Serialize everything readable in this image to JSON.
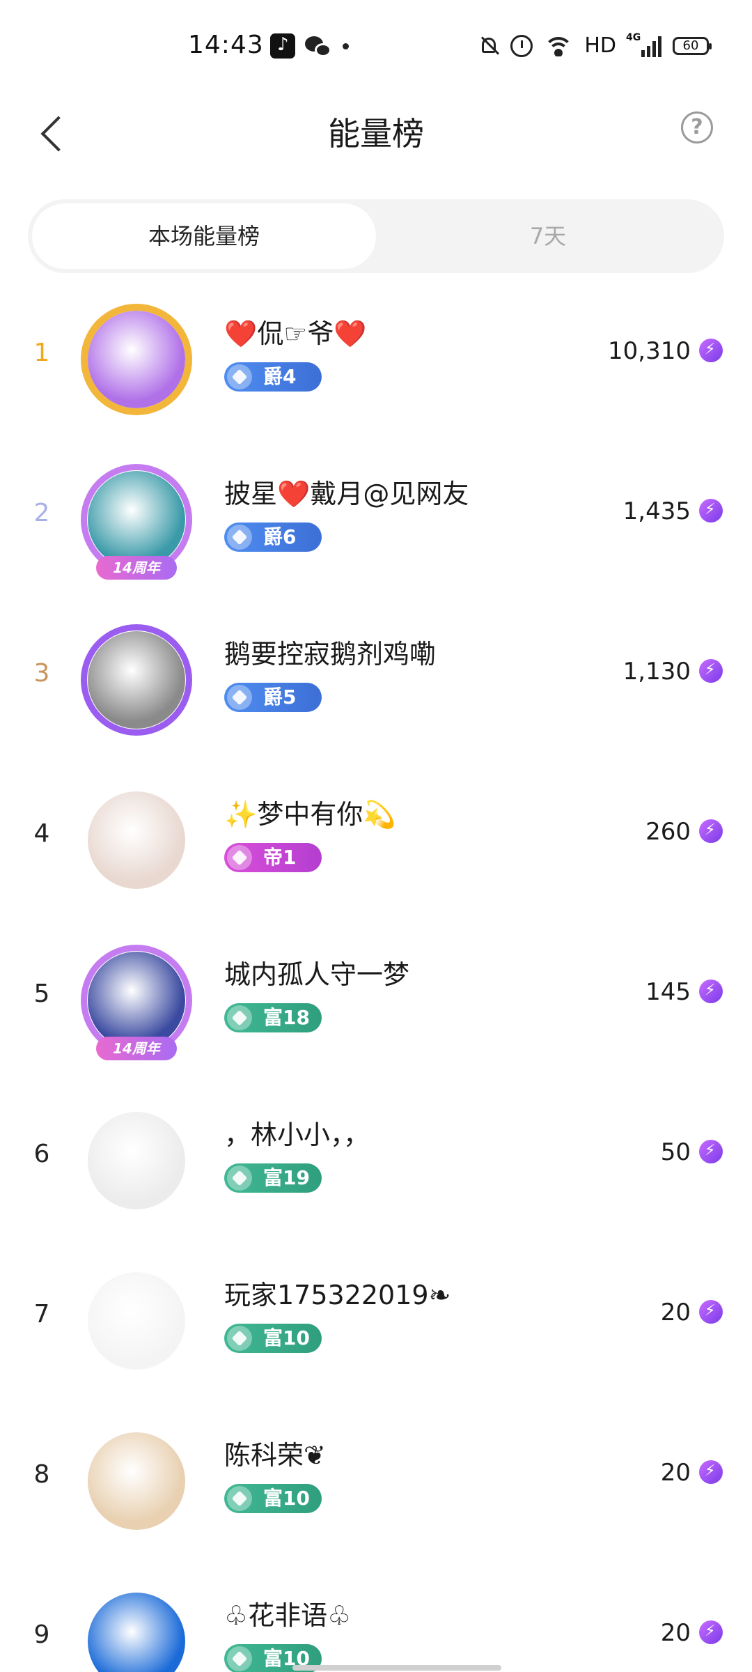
{
  "status_bar": {
    "time": "14:43",
    "network": "HD",
    "signal_label": "4G",
    "battery": "60"
  },
  "header": {
    "title": "能量榜"
  },
  "tabs": [
    {
      "label": "本场能量榜",
      "active": true
    },
    {
      "label": "7天",
      "active": false
    }
  ],
  "rows": [
    {
      "rank": "1",
      "rank_color": "#f0a81e",
      "name": "❤️侃☞爷❤️",
      "level": "爵4",
      "level_type": "jue",
      "score": "10,310",
      "avatar_color": "#b070e8",
      "frame": "tiger",
      "frame_badge": ""
    },
    {
      "rank": "2",
      "rank_color": "#a8b0e8",
      "name": "披星❤️戴月@见网友",
      "level": "爵6",
      "level_type": "jue",
      "score": "1,435",
      "avatar_color": "#3a9aa8",
      "frame": "anniv",
      "frame_badge": "14周年"
    },
    {
      "rank": "3",
      "rank_color": "#c8955a",
      "name": "鹅要控寂鹅剂鸡嘞",
      "level": "爵5",
      "level_type": "jue",
      "score": "1,130",
      "avatar_color": "#8a8a8a",
      "frame": "purple",
      "frame_badge": ""
    },
    {
      "rank": "4",
      "rank_color": "#222222",
      "name": "✨梦中有你💫",
      "level": "帝1",
      "level_type": "di",
      "score": "260",
      "avatar_color": "#e8d8d0",
      "frame": "none",
      "frame_badge": ""
    },
    {
      "rank": "5",
      "rank_color": "#222222",
      "name": "城内孤人守一梦",
      "level": "富18",
      "level_type": "fu",
      "score": "145",
      "avatar_color": "#3a4aa0",
      "frame": "anniv",
      "frame_badge": "14周年"
    },
    {
      "rank": "6",
      "rank_color": "#222222",
      "name": "，林小小，，",
      "level": "富19",
      "level_type": "fu",
      "score": "50",
      "avatar_color": "#ececec",
      "frame": "none",
      "frame_badge": ""
    },
    {
      "rank": "7",
      "rank_color": "#222222",
      "name": "玩家175322019❧",
      "level": "富10",
      "level_type": "fu",
      "score": "20",
      "avatar_color": "#f4f4f4",
      "frame": "none",
      "frame_badge": ""
    },
    {
      "rank": "8",
      "rank_color": "#222222",
      "name": "陈科荣❦",
      "level": "富10",
      "level_type": "fu",
      "score": "20",
      "avatar_color": "#e8d0b0",
      "frame": "none",
      "frame_badge": ""
    },
    {
      "rank": "9",
      "rank_color": "#222222",
      "name": "♧花非语♧",
      "level": "富10",
      "level_type": "fu",
      "score": "20",
      "avatar_color": "#1a6ad8",
      "frame": "none",
      "frame_badge": ""
    }
  ]
}
